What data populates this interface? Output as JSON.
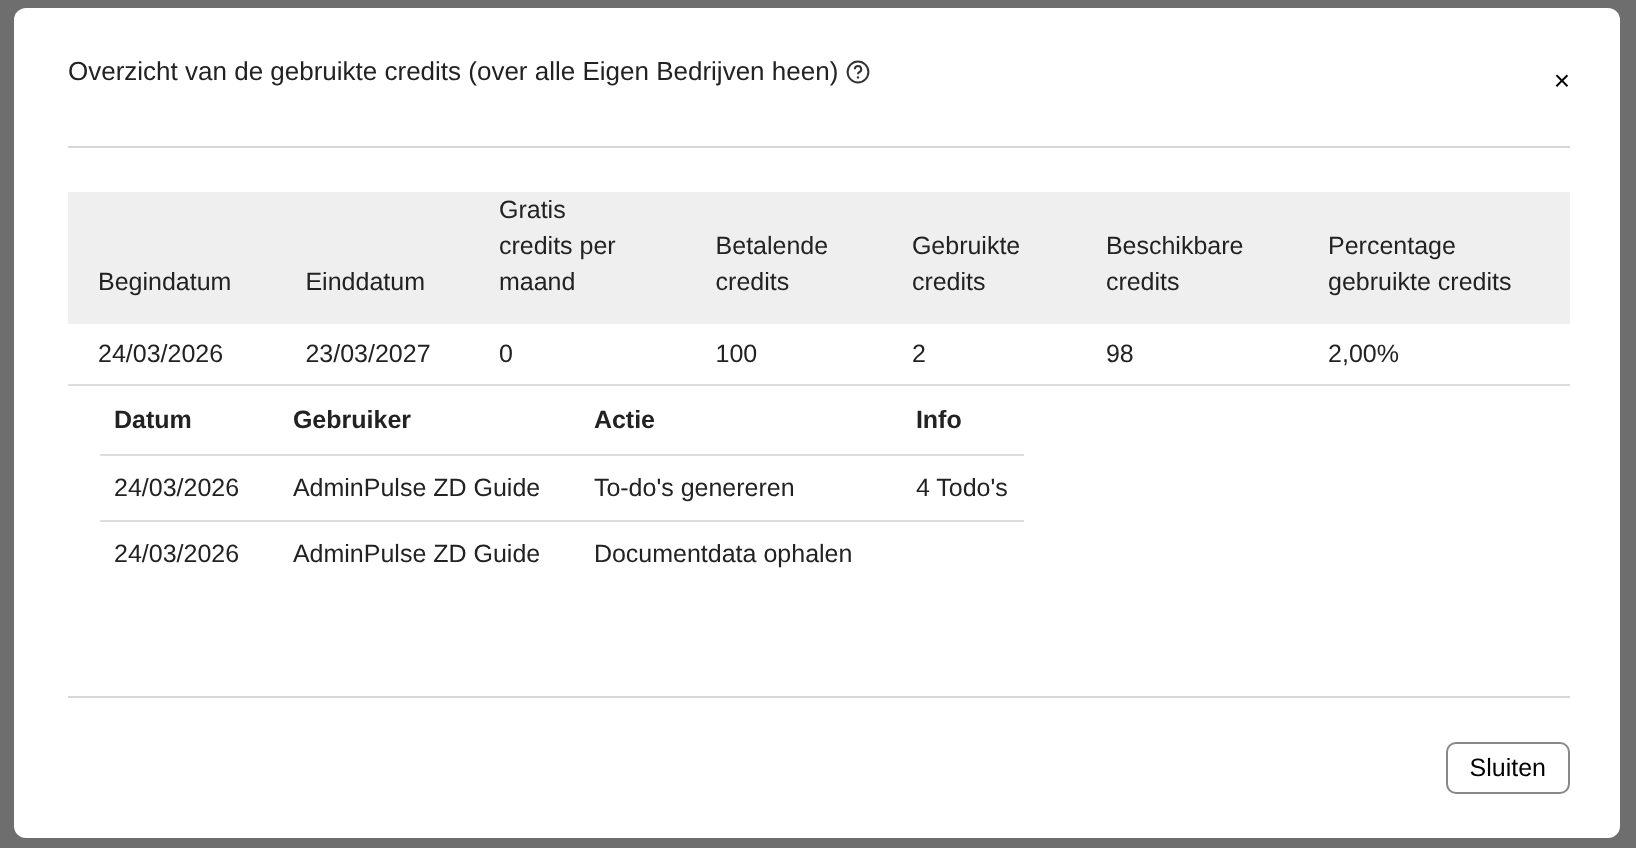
{
  "modal": {
    "title": "Overzicht van de gebruikte credits (over alle Eigen Bedrijven heen)",
    "close": "×",
    "table": {
      "columns": [
        "Begindatum",
        "Einddatum",
        "Gratis credits per maand",
        "Betalende credits",
        "Gebruikte credits",
        "Beschikbare credits",
        "Percentage gebruikte credits"
      ],
      "rows": [
        [
          "24/03/2026",
          "23/03/2027",
          "0",
          "100",
          "2",
          "98",
          "2,00%"
        ]
      ]
    },
    "details": {
      "columns": [
        "Datum",
        "Gebruiker",
        "Actie",
        "Info"
      ],
      "rows": [
        [
          "24/03/2026",
          "AdminPulse ZD Guide",
          "To-do's genereren",
          "4 Todo's"
        ],
        [
          "24/03/2026",
          "AdminPulse ZD Guide",
          "Documentdata ophalen",
          ""
        ]
      ]
    },
    "buttons": [
      "Sluiten"
    ]
  }
}
